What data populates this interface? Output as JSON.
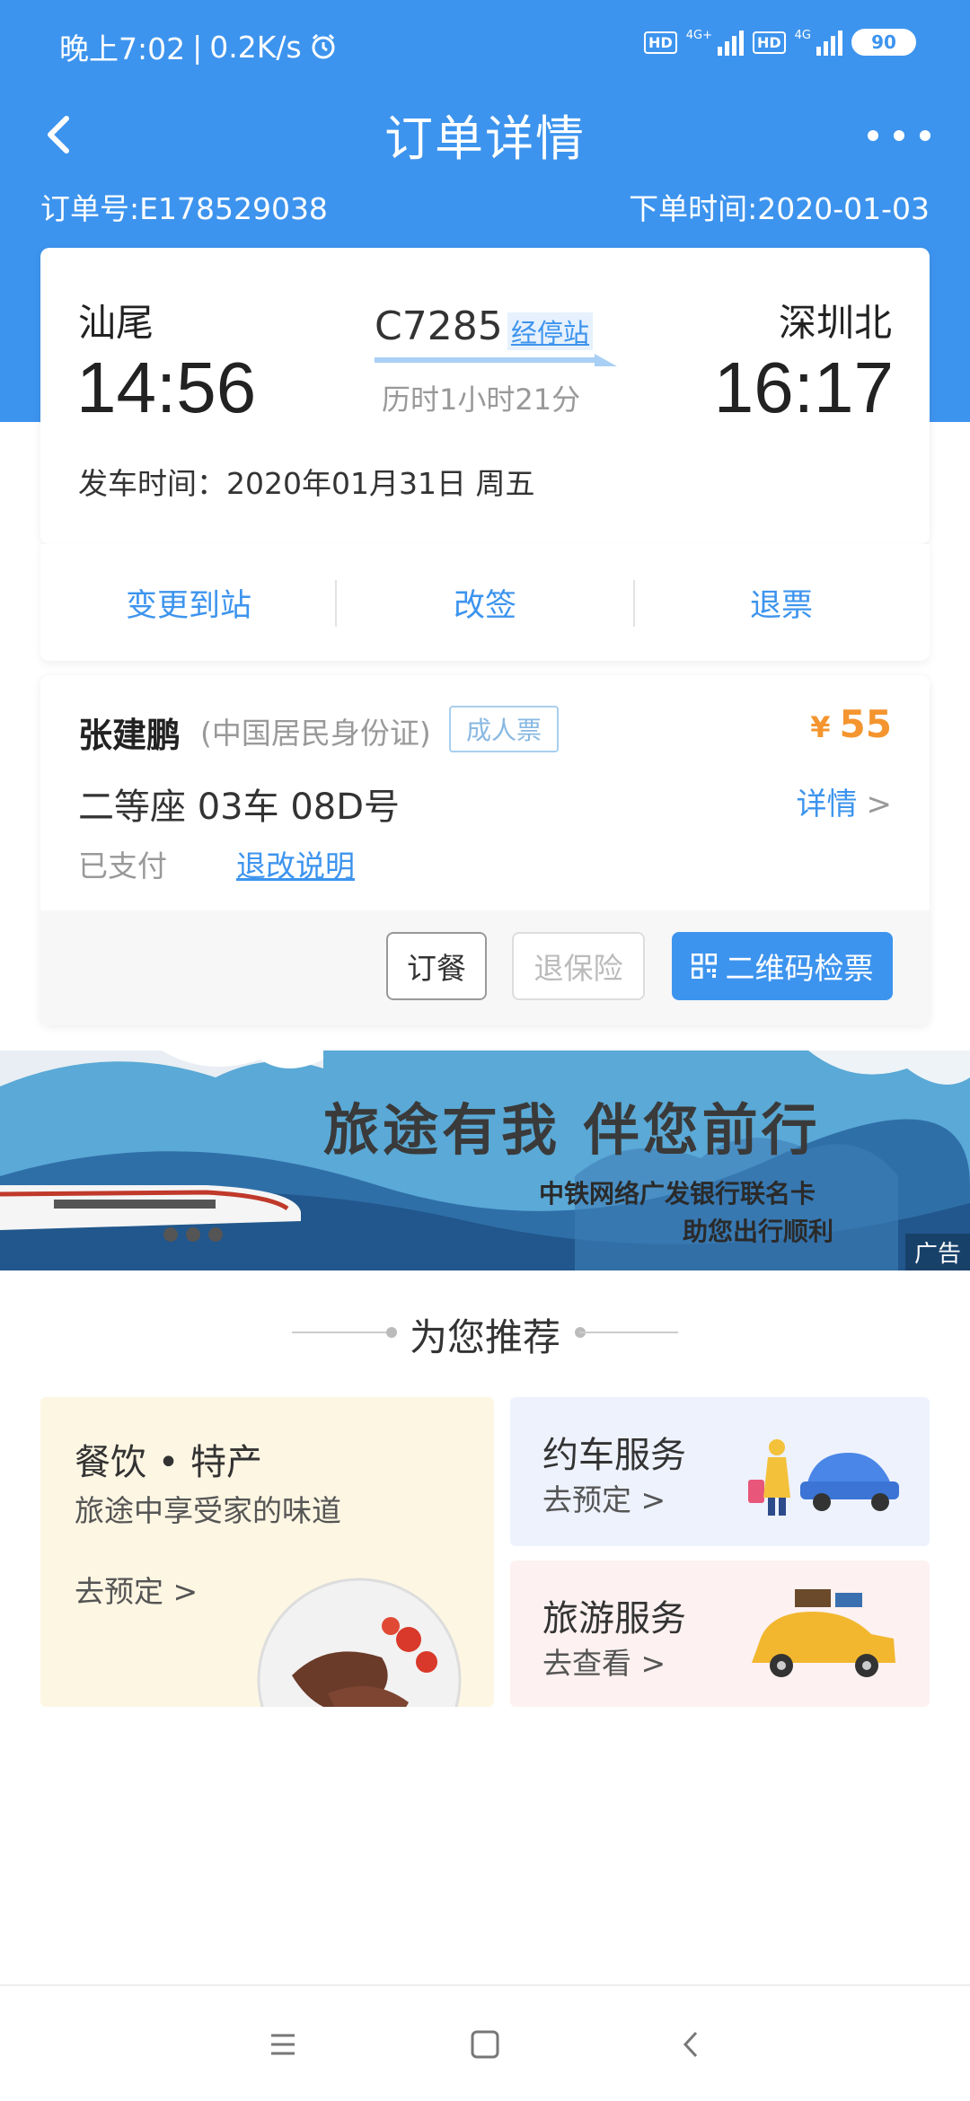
{
  "status_bar": {
    "time": "晚上7:02",
    "speed": "0.2K/s",
    "hd1": "HD",
    "net1": "4G+",
    "hd2": "HD",
    "net2": "4G",
    "battery": "90"
  },
  "nav": {
    "title": "订单详情"
  },
  "order": {
    "order_no": "订单号:E178529038",
    "order_time": "下单时间:2020-01-03"
  },
  "trip": {
    "from_station": "汕尾",
    "from_time": "14:56",
    "train_no": "C7285",
    "stops_label": "经停站",
    "duration": "历时1小时21分",
    "to_station": "深圳北",
    "to_time": "16:17",
    "depart_date": "发车时间：2020年01月31日 周五"
  },
  "actions": {
    "change_station": "变更到站",
    "reschedule": "改签",
    "refund": "退票"
  },
  "passenger": {
    "name": "张建鹏",
    "id_type": "(中国居民身份证)",
    "ticket_type": "成人票",
    "currency": "¥",
    "price": "55",
    "seat": "二等座 03车 08D号",
    "detail": "详情",
    "paid": "已支付",
    "refund_note": "退改说明",
    "btn_meal": "订餐",
    "btn_insurance": "退保险",
    "btn_qr": "二维码检票"
  },
  "banner": {
    "title": "旅途有我 伴您前行",
    "sub1": "中铁网络广发银行联名卡",
    "sub2": "助您出行顺利",
    "ad": "广告"
  },
  "recommend": {
    "title": "为您推荐",
    "food": {
      "title": "餐饮 • 特产",
      "subtitle": "旅途中享受家的味道",
      "action": "去预定 >"
    },
    "car": {
      "title": "约车服务",
      "action": "去预定 >"
    },
    "tour": {
      "title": "旅游服务",
      "action": "去查看 >"
    }
  },
  "colors": {
    "primary": "#3d94ee",
    "price": "#f4952f"
  }
}
